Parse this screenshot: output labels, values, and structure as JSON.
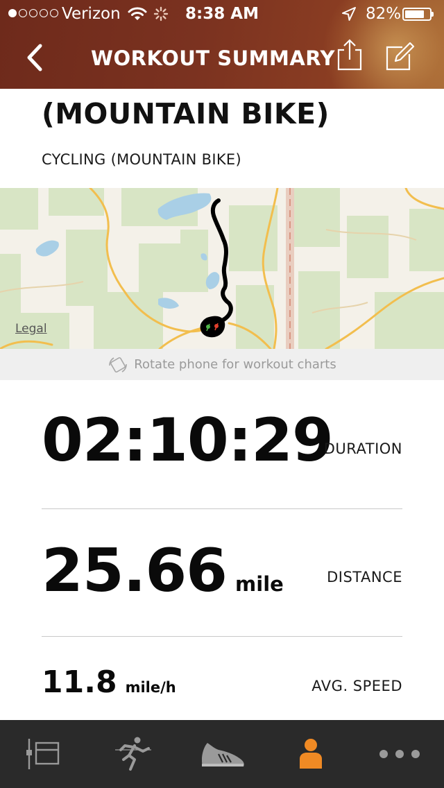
{
  "status_bar": {
    "carrier": "Verizon",
    "time": "8:38 AM",
    "battery_percent": "82%",
    "battery_level": 0.82,
    "signal_bars_filled": 1,
    "signal_bars_total": 5
  },
  "nav": {
    "title": "WORKOUT SUMMARY",
    "back_icon": "chevron-left-icon",
    "share_icon": "share-icon",
    "edit_icon": "edit-icon"
  },
  "workout": {
    "title": "(MOUNTAIN BIKE)",
    "subtitle": "CYCLING (MOUNTAIN BIKE)"
  },
  "map": {
    "legal_label": "Legal",
    "route_color": "#000000"
  },
  "rotate_hint": {
    "label": "Rotate phone for workout charts",
    "icon": "rotate-phone-icon"
  },
  "stats": {
    "duration": {
      "value": "02:10:29",
      "unit": "",
      "label": "DURATION"
    },
    "distance": {
      "value": "25.66",
      "unit": "mile",
      "label": "DISTANCE"
    },
    "avg_speed": {
      "value": "11.8",
      "unit": "mile/h",
      "label": "AVG. SPEED"
    }
  },
  "tab_bar": {
    "accent_color": "#f08a24",
    "inactive_color": "#9a9a9a",
    "tabs": [
      {
        "icon": "feed-icon",
        "active": false
      },
      {
        "icon": "runner-icon",
        "active": false
      },
      {
        "icon": "shoe-icon",
        "active": false
      },
      {
        "icon": "profile-icon",
        "active": true
      },
      {
        "icon": "more-icon",
        "active": false
      }
    ]
  }
}
